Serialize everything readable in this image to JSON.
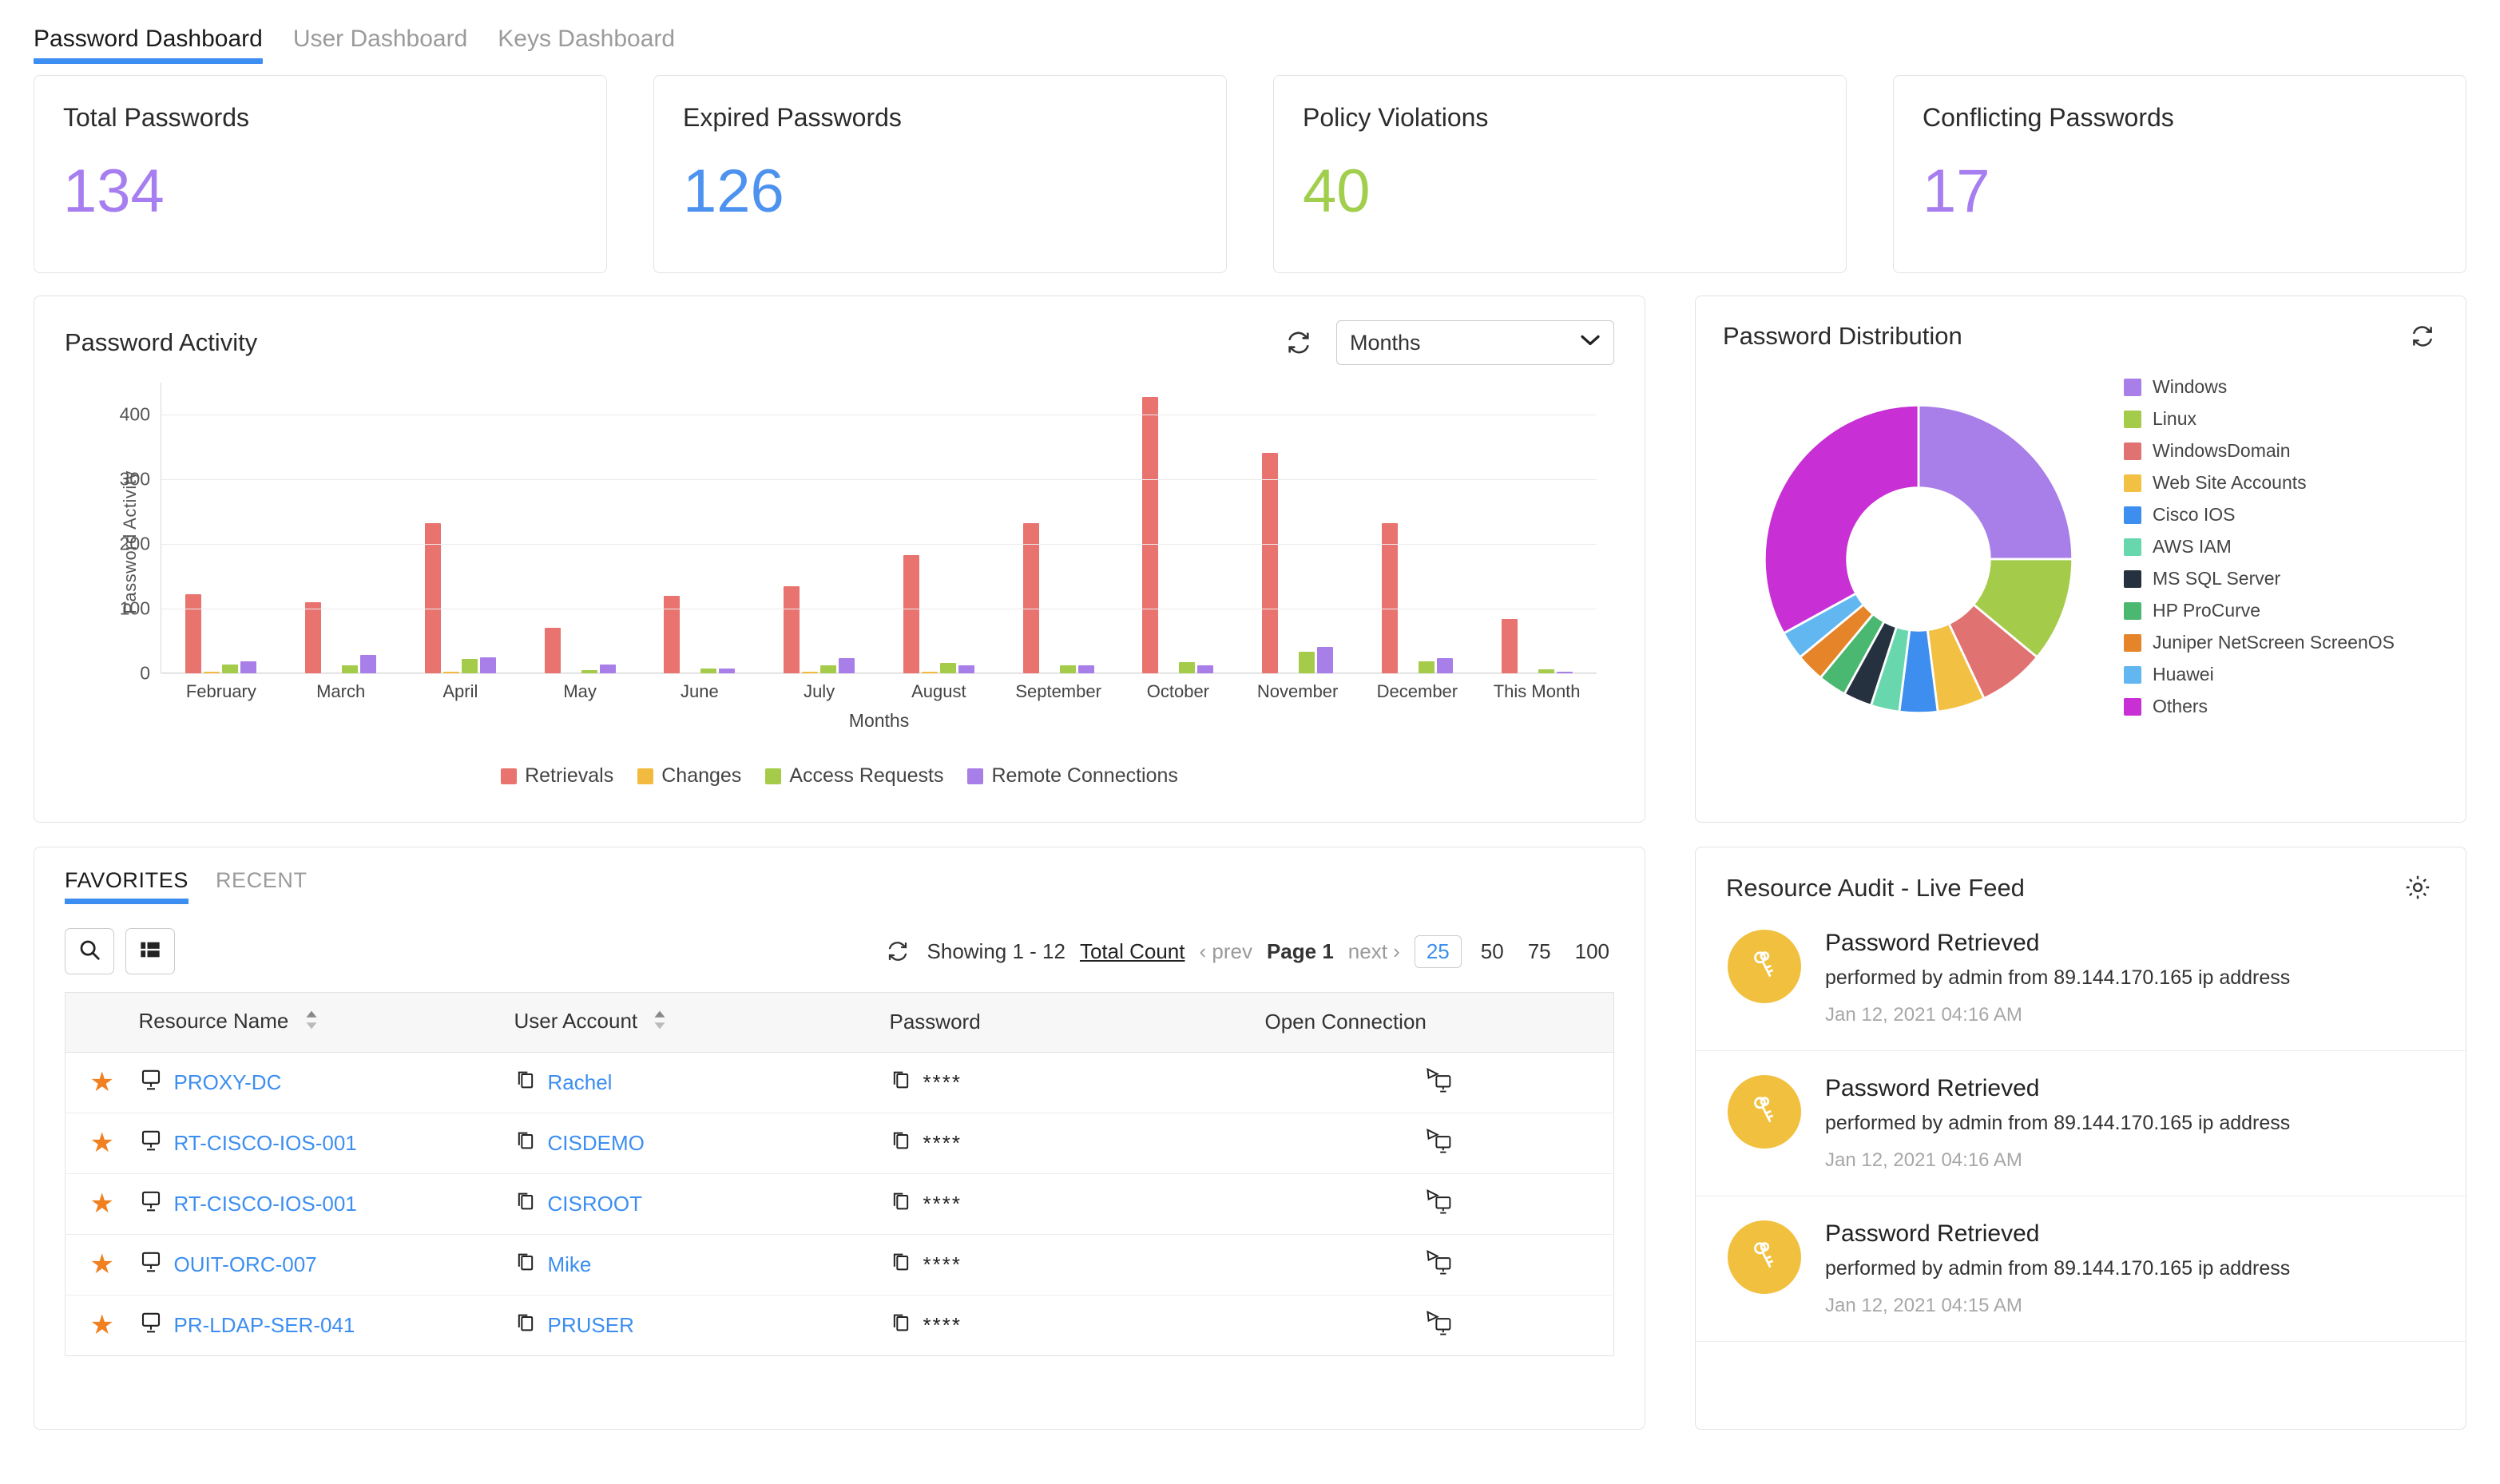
{
  "topnav": {
    "tabs": [
      {
        "label": "Password Dashboard",
        "active": true
      },
      {
        "label": "User Dashboard",
        "active": false
      },
      {
        "label": "Keys Dashboard",
        "active": false
      }
    ]
  },
  "stats": [
    {
      "title": "Total Passwords",
      "value": "134",
      "color": "#a77ef0"
    },
    {
      "title": "Expired Passwords",
      "value": "126",
      "color": "#4d92ef"
    },
    {
      "title": "Policy Violations",
      "value": "40",
      "color": "#a2ce4d"
    },
    {
      "title": "Conflicting Passwords",
      "value": "17",
      "color": "#a77ef0"
    }
  ],
  "activity": {
    "title": "Password Activity",
    "refresh_icon": "refresh-icon",
    "period_selected": "Months",
    "period_options": [
      "Months"
    ]
  },
  "distribution": {
    "title": "Password Distribution",
    "refresh_icon": "refresh-icon"
  },
  "favorites": {
    "tabs": [
      {
        "label": "FAVORITES",
        "active": true
      },
      {
        "label": "RECENT",
        "active": false
      }
    ],
    "search_icon": "search-icon",
    "columns_icon": "columns-icon",
    "pager": {
      "refresh_icon": "refresh-icon",
      "showing": "Showing 1 - 12",
      "total_count": "Total Count",
      "prev": "prev",
      "page": "Page 1",
      "next": "next",
      "sizes": [
        "25",
        "50",
        "75",
        "100"
      ],
      "size_active": "25"
    },
    "headers": [
      "Resource Name",
      "User Account",
      "Password",
      "Open Connection"
    ],
    "rows": [
      {
        "favorite": true,
        "resource": "PROXY-DC",
        "account": "Rachel",
        "password": "****"
      },
      {
        "favorite": true,
        "resource": "RT-CISCO-IOS-001",
        "account": "CISDEMO",
        "password": "****"
      },
      {
        "favorite": true,
        "resource": "RT-CISCO-IOS-001",
        "account": "CISROOT",
        "password": "****"
      },
      {
        "favorite": true,
        "resource": "OUIT-ORC-007",
        "account": "Mike",
        "password": "****"
      },
      {
        "favorite": true,
        "resource": "PR-LDAP-SER-041",
        "account": "PRUSER",
        "password": "****"
      }
    ]
  },
  "audit": {
    "title": "Resource Audit - Live Feed",
    "settings_icon": "gear-icon",
    "items": [
      {
        "title": "Password Retrieved",
        "desc": "performed by admin from 89.144.170.165 ip address",
        "time": "Jan 12, 2021 04:16 AM",
        "avatar_icon": "keys-icon"
      },
      {
        "title": "Password Retrieved",
        "desc": "performed by admin from 89.144.170.165 ip address",
        "time": "Jan 12, 2021 04:16 AM",
        "avatar_icon": "keys-icon"
      },
      {
        "title": "Password Retrieved",
        "desc": "performed by admin from 89.144.170.165 ip address",
        "time": "Jan 12, 2021 04:15 AM",
        "avatar_icon": "keys-icon"
      }
    ]
  },
  "chart_data": [
    {
      "type": "bar",
      "title": "Password Activity",
      "xlabel": "Months",
      "ylabel": "Password Activity",
      "ylim": [
        0,
        450
      ],
      "yticks": [
        0,
        100,
        200,
        300,
        400
      ],
      "grid": true,
      "legend_position": "bottom",
      "categories": [
        "February",
        "March",
        "April",
        "May",
        "June",
        "July",
        "August",
        "September",
        "October",
        "November",
        "December",
        "This Month"
      ],
      "series": [
        {
          "name": "Retrievals",
          "color": "#e8736f",
          "values": [
            122,
            110,
            233,
            71,
            120,
            135,
            183,
            233,
            428,
            341,
            233,
            84
          ]
        },
        {
          "name": "Changes",
          "color": "#f2bb3f",
          "values": [
            3,
            0,
            3,
            0,
            0,
            3,
            3,
            0,
            0,
            0,
            0,
            0
          ]
        },
        {
          "name": "Access Requests",
          "color": "#a4cc4a",
          "values": [
            14,
            12,
            22,
            5,
            7,
            13,
            16,
            12,
            17,
            33,
            18,
            6
          ]
        },
        {
          "name": "Remote Connections",
          "color": "#a87ee8",
          "values": [
            18,
            29,
            25,
            14,
            8,
            23,
            13,
            12,
            13,
            41,
            24,
            3
          ]
        }
      ]
    },
    {
      "type": "pie",
      "title": "Password Distribution",
      "donut": true,
      "legend_position": "right",
      "labels": [
        "Windows",
        "Linux",
        "WindowsDomain",
        "Web Site Accounts",
        "Cisco IOS",
        "AWS IAM",
        "MS SQL Server",
        "HP ProCurve",
        "Juniper NetScreen ScreenOS",
        "Huawei",
        "Others"
      ],
      "colors": [
        "#a87ee8",
        "#a4cc4a",
        "#e07271",
        "#f2c043",
        "#3e8ef0",
        "#68d7ad",
        "#26313f",
        "#4ab871",
        "#e58428",
        "#62b7f0",
        "#c82fd4"
      ],
      "values": [
        25,
        11,
        7,
        5,
        4,
        3,
        3,
        3,
        3,
        3,
        33
      ]
    }
  ]
}
